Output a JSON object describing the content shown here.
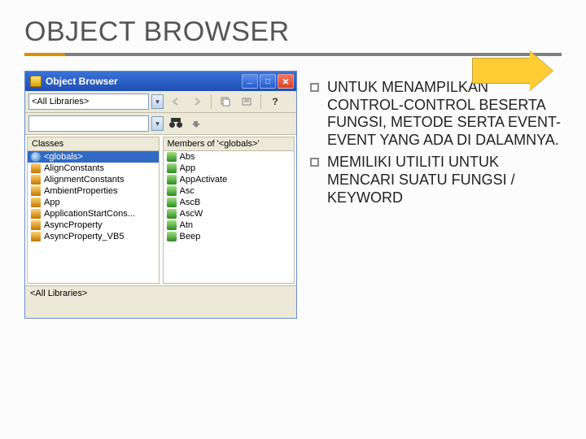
{
  "title": "OBJECT BROWSER",
  "arrow_color": "#ffcc33",
  "window": {
    "title": "Object Browser",
    "library_selected": "<All Libraries>",
    "search_value": "",
    "classes_header": "Classes",
    "members_header": "Members of '<globals>'",
    "classes": [
      {
        "icon": "global",
        "label": "<globals>",
        "selected": true
      },
      {
        "icon": "class",
        "label": "AlignConstants"
      },
      {
        "icon": "class",
        "label": "AlignmentConstants"
      },
      {
        "icon": "class",
        "label": "AmbientProperties"
      },
      {
        "icon": "class",
        "label": "App"
      },
      {
        "icon": "class",
        "label": "ApplicationStartCons..."
      },
      {
        "icon": "class",
        "label": "AsyncProperty"
      },
      {
        "icon": "class",
        "label": "AsyncProperty_VB5"
      }
    ],
    "members": [
      {
        "icon": "member",
        "label": "Abs"
      },
      {
        "icon": "member",
        "label": "App"
      },
      {
        "icon": "member",
        "label": "AppActivate"
      },
      {
        "icon": "member",
        "label": "Asc"
      },
      {
        "icon": "member",
        "label": "AscB"
      },
      {
        "icon": "member",
        "label": "AscW"
      },
      {
        "icon": "member",
        "label": "Atn"
      },
      {
        "icon": "member",
        "label": "Beep"
      }
    ],
    "footer": "<All Libraries>"
  },
  "bullet1": "UNTUK MENAMPILKAN CONTROL-CONTROL BESERTA FUNGSI, METODE SERTA EVENT-EVENT YANG ADA DI DALAMNYA.",
  "bullet2": "MEMILIKI UTILITI UNTUK MENCARI SUATU FUNGSI / KEYWORD"
}
